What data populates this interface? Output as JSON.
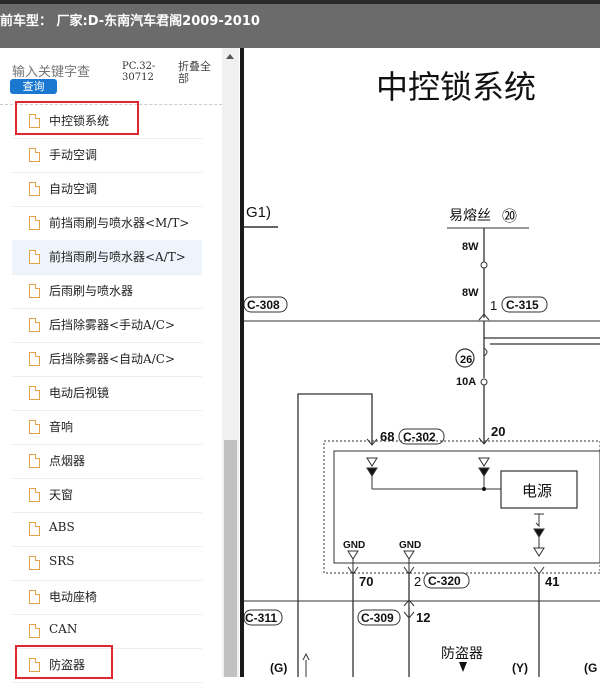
{
  "window": {
    "title": "前车型： 厂家:D-东南汽车君阁2009-2010"
  },
  "search": {
    "placeholder": "输入关键字查",
    "button_label": "查询",
    "code": "PC.32-30712",
    "collapse_all": "折叠全部"
  },
  "tree": {
    "items": [
      {
        "label": "中控锁系统",
        "highlighted": true
      },
      {
        "label": "手动空调"
      },
      {
        "label": "自动空调"
      },
      {
        "label": "前挡雨刷与喷水器<M/T>"
      },
      {
        "label": "前挡雨刷与喷水器<A/T>",
        "hover": true
      },
      {
        "label": "后雨刷与喷水器"
      },
      {
        "label": "后挡除雾器<手动A/C>"
      },
      {
        "label": "后挡除雾器<自动A/C>"
      },
      {
        "label": "电动后视镜"
      },
      {
        "label": "音响"
      },
      {
        "label": "点烟器"
      },
      {
        "label": "天窗"
      },
      {
        "label": "ABS"
      },
      {
        "label": "SRS"
      },
      {
        "label": "电动座椅"
      },
      {
        "label": "CAN"
      },
      {
        "label": "防盗器",
        "highlighted": true
      }
    ]
  },
  "diagram": {
    "title": "中控锁系统",
    "labels": {
      "g1": "G1)",
      "fuse": "易熔丝",
      "fuse_num": "⑳",
      "w8a": "8W",
      "w8b": "8W",
      "pin1": "1",
      "c315": "C-315",
      "c308": "C-308",
      "fuse26": "26",
      "amp10": "10A",
      "pin68": "68",
      "c302": "C-302",
      "pin20": "20",
      "power": "电源",
      "gnd1": "GND",
      "gnd2": "GND",
      "pin70": "70",
      "pin2": "2",
      "c320": "C-320",
      "pin41": "41",
      "c311": "C-311",
      "c309": "C-309",
      "pin12": "12",
      "antitheft": "防盗器",
      "g": "(G)",
      "y": "(Y)",
      "g2": "(G"
    }
  },
  "colors": {
    "highlight_box": "#e0262f",
    "search_button": "#1b78d0",
    "titlebar": "#6b6b6b"
  }
}
